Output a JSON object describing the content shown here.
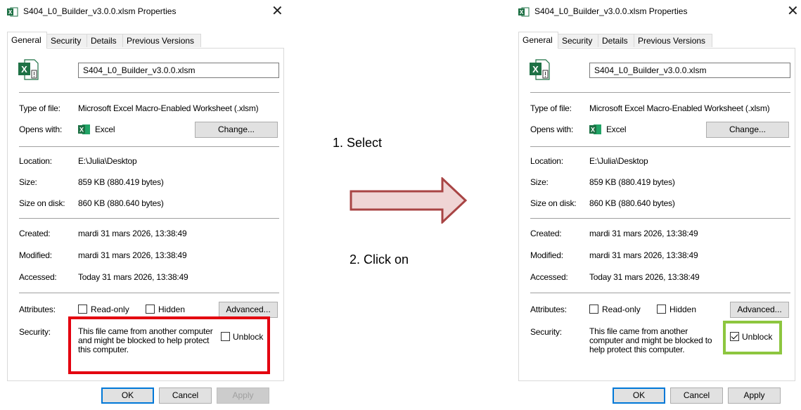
{
  "dialog": {
    "title": "S404_L0_Builder_v3.0.0.xlsm Properties",
    "close_symbol": "✕",
    "tabs": [
      "General",
      "Security",
      "Details",
      "Previous Versions"
    ],
    "active_tab": "General",
    "filename": "S404_L0_Builder_v3.0.0.xlsm",
    "type_of_file": {
      "label": "Type of file:",
      "value": "Microsoft Excel Macro-Enabled Worksheet (.xlsm)"
    },
    "opens_with": {
      "label": "Opens with:",
      "value": "Excel",
      "button": "Change..."
    },
    "location": {
      "label": "Location:",
      "value": "E:\\Julia\\Desktop"
    },
    "size": {
      "label": "Size:",
      "value": "859 KB (880.419 bytes)"
    },
    "size_on_disk": {
      "label": "Size on disk:",
      "value": "860 KB (880.640 bytes)"
    },
    "created": {
      "label": "Created:",
      "value": "mardi 31 mars 2026, 13:38:49"
    },
    "modified": {
      "label": "Modified:",
      "value": "mardi 31 mars 2026, 13:38:49"
    },
    "accessed": {
      "label": "Accessed:",
      "value": "Today 31 mars 2026, 13:38:49"
    },
    "attributes": {
      "label": "Attributes:",
      "read_only": "Read-only",
      "hidden": "Hidden",
      "advanced_button": "Advanced..."
    },
    "security": {
      "label": "Security:",
      "text": "This file came from another computer and might be blocked to help protect this computer.",
      "unblock": "Unblock"
    },
    "buttons": {
      "ok": "OK",
      "cancel": "Cancel",
      "apply": "Apply"
    }
  },
  "left_state": {
    "unblock_checked": false,
    "highlight_color": "#e3000f"
  },
  "right_state": {
    "unblock_checked": true,
    "highlight_color": "#8dc63f"
  },
  "annotations": {
    "step1": "1.  Select",
    "step2": "2. Click on"
  },
  "colors": {
    "arrow_fill": "#efd5d5",
    "arrow_stroke": "#a84444",
    "excel_green": "#1e7145"
  },
  "icons": [
    "excel-file-icon",
    "excel-app-icon",
    "close-icon",
    "arrow-right-icon"
  ]
}
